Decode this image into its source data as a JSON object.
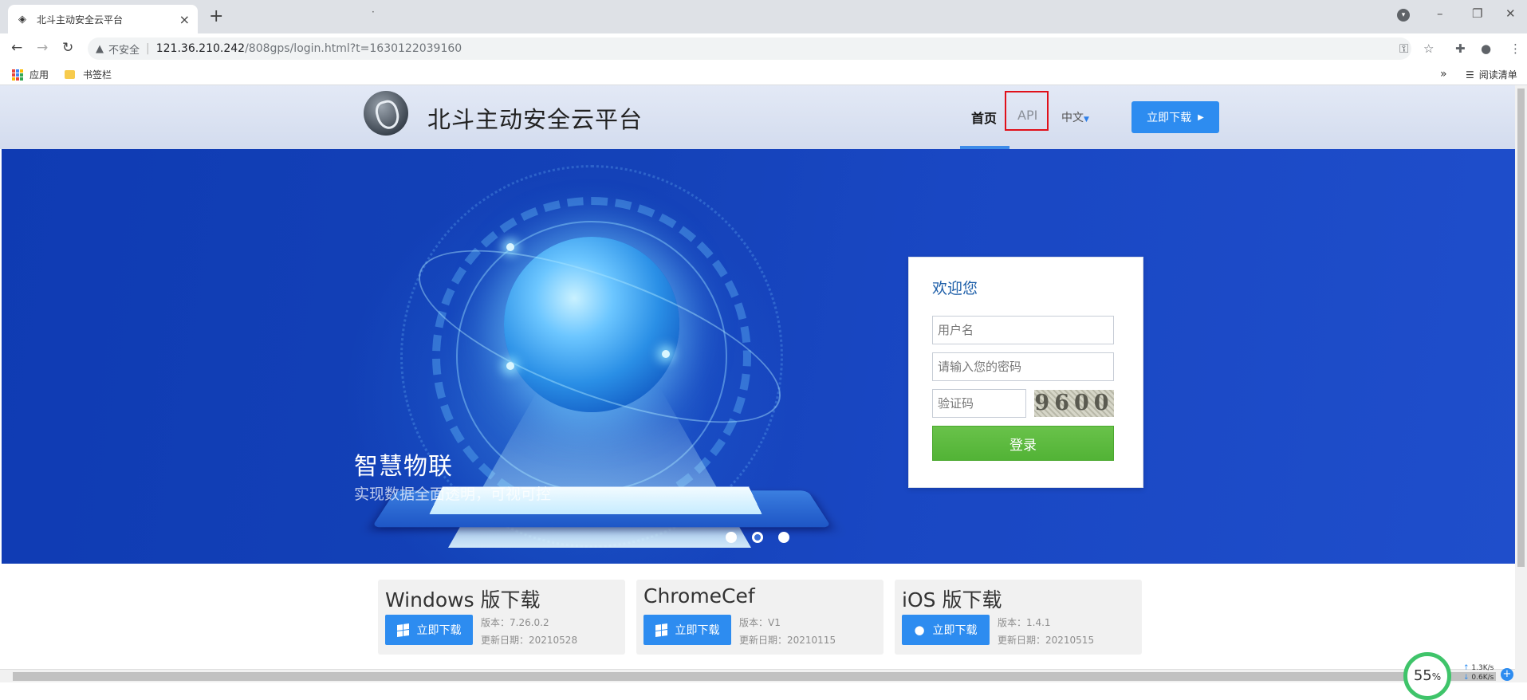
{
  "browser": {
    "tab_title": "北斗主动安全云平台",
    "tab_close": "×",
    "new_tab": "+",
    "title_dot": "·",
    "address": {
      "insecure_label": "不安全",
      "separator": "|",
      "url_host": "121.36.210.242",
      "url_path": "/808gps/login.html?t=1630122039160"
    },
    "bookmarks": {
      "apps_label": "应用",
      "folder_label": "书签栏",
      "reading_list_label": "阅读清单"
    }
  },
  "site": {
    "title": "北斗主动安全云平台",
    "nav": {
      "home": "首页",
      "api": "API",
      "language": "中文",
      "download": "立即下载"
    }
  },
  "hero": {
    "title": "智慧物联",
    "subtitle": "实现数据全面透明，可视可控",
    "slides": 3,
    "active_slide": 2
  },
  "login": {
    "welcome": "欢迎您",
    "username_placeholder": "用户名",
    "password_placeholder": "请输入您的密码",
    "captcha_placeholder": "验证码",
    "captcha_code": "9600",
    "submit": "登录"
  },
  "downloads": [
    {
      "title": "Windows 版下载",
      "button": "立即下载",
      "version": "版本：7.26.0.2",
      "updated": "更新日期：20210528",
      "icon": "windows-icon"
    },
    {
      "title": "ChromeCef",
      "button": "立即下载",
      "version": "版本：V1",
      "updated": "更新日期：20210115",
      "icon": "windows-icon"
    },
    {
      "title": "iOS 版下载",
      "button": "立即下载",
      "version": "版本：1.4.1",
      "updated": "更新日期：20210515",
      "icon": "apple-icon"
    }
  ],
  "widgets": {
    "cpu_percent": "55",
    "percent_sign": "%",
    "up_speed": "1.3K/s",
    "down_speed": "0.6K/s"
  },
  "colors": {
    "accent": "#2d8cf0",
    "login_green": "#5cb83c",
    "hero_blue": "#1442b8",
    "highlight_red": "#e0101a"
  }
}
